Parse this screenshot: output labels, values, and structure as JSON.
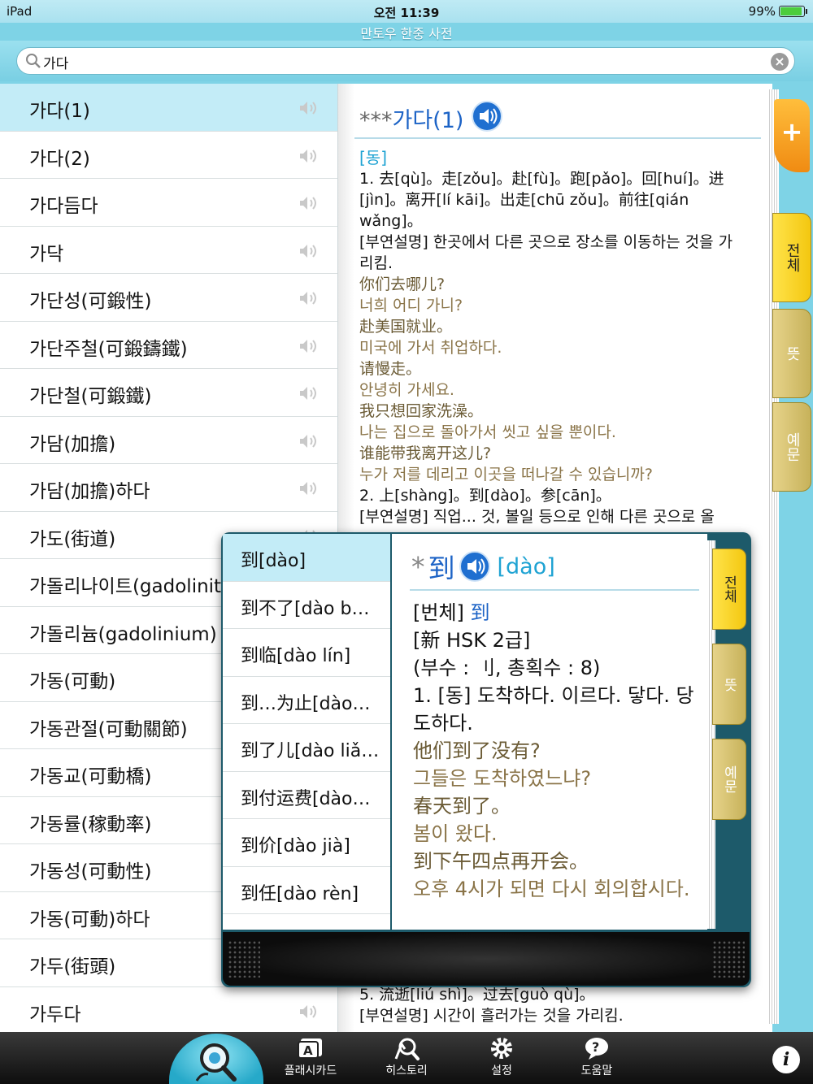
{
  "status": {
    "device": "iPad",
    "time": "오전 11:39",
    "battery": "99%"
  },
  "app_title": "만토우 한중 사전",
  "search": {
    "value": "가다",
    "placeholder": ""
  },
  "word_list": [
    "가다(1)",
    "가다(2)",
    "가다듬다",
    "가닥",
    "가단성(可鍛性)",
    "가단주철(可鍛鑄鐵)",
    "가단철(可鍛鐵)",
    "가담(加擔)",
    "가담(加擔)하다",
    "가도(街道)",
    "가돌리나이트(gadolinite)",
    "가돌리늄(gadolinium)",
    "가동(可動)",
    "가동관절(可動關節)",
    "가동교(可動橋)",
    "가동률(稼動率)",
    "가동성(可動性)",
    "가동(可動)하다",
    "가두(街頭)",
    "가두다"
  ],
  "detail": {
    "stars": "***",
    "headword": "가다(1)",
    "pos": "[동]",
    "def1": "1. 去[qù]。走[zǒu]。赴[fù]。跑[pǎo]。回[huí]。进[jìn]。离开[lí kāi]。出走[chū zǒu]。前往[qián wǎng]。",
    "note": "[부연설명] 한곳에서 다른 곳으로 장소를 이동하는 것을 가리킴.",
    "examples": [
      {
        "zh": "你们去哪儿?",
        "ko": "너희 어디 가니?"
      },
      {
        "zh": "赴美国就业。",
        "ko": "미국에 가서 취업하다."
      },
      {
        "zh": "请慢走。",
        "ko": "안녕히 가세요."
      },
      {
        "zh": "我只想回家洗澡。",
        "ko": "나는 집으로 돌아가서 씻고 싶을 뿐이다."
      },
      {
        "zh": "谁能带我离开这儿?",
        "ko": "누가 저를 데리고 이곳을 떠나갈 수 있습니까?"
      }
    ],
    "def2": "2. 上[shàng]。到[dào]。参[cān]。",
    "def2_note_partial": "[부연설명] 직업... 것, 볼일 등으로 인해 다른 곳으로 올",
    "def5_partial": "5. 流逝[liú shì]。过去[guò qù]。",
    "def5_note": "[부연설명] 시간이 흘러가는 것을 가리킴.",
    "tabs": {
      "all": "전체",
      "meaning": "뜻",
      "example": "예문"
    }
  },
  "popup": {
    "list": [
      "到[dào]",
      "到不了[dào b…",
      "到临[dào lín]",
      "到…为止[dào…",
      "到了儿[dào liǎ…",
      "到付运费[dào…",
      "到价[dào jià]",
      "到任[dào rèn]"
    ],
    "detail": {
      "stars": "*",
      "headword": "到",
      "pinyin": "[dào]",
      "trad_label": "[번체]",
      "trad_value": "到",
      "hsk": "[新 HSK 2급]",
      "radical": "(부수 : 刂, 총획수 : 8)",
      "def1": "1. [동] 도착하다. 이르다. 닿다. 당도하다.",
      "examples": [
        {
          "zh": "他们到了没有?",
          "ko": "그들은 도착하였느냐?"
        },
        {
          "zh": "春天到了。",
          "ko": "봄이 왔다."
        },
        {
          "zh": "到下午四点再开会。",
          "ko": "오후 4시가 되면 다시 회의합시다."
        }
      ],
      "tabs": {
        "all": "전체",
        "meaning": "뜻",
        "example": "예문"
      }
    }
  },
  "tabbar": {
    "search_icon": "magnifier-icon",
    "items": [
      {
        "label": "플래시카드",
        "icon": "flashcard-icon"
      },
      {
        "label": "히스토리",
        "icon": "history-icon"
      },
      {
        "label": "설정",
        "icon": "gear-icon"
      },
      {
        "label": "도움말",
        "icon": "help-icon"
      }
    ],
    "info_glyph": "i"
  },
  "colors": {
    "accent": "#1c63c6",
    "pos_blue": "#1fa3d3",
    "example_olive": "#8a7448",
    "tab_yellow": "#f3c710"
  }
}
